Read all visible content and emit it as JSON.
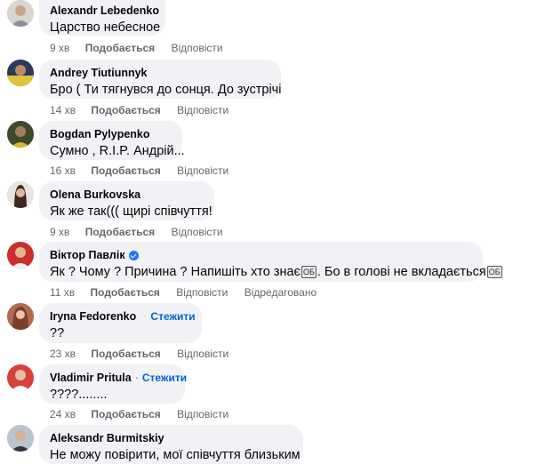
{
  "comments": [
    {
      "name": "Alexandr Lebedenko",
      "verified": false,
      "follow": "",
      "text": "Царство небесное",
      "time": "9 хв",
      "like": "Подобається",
      "reply": "Відповісти",
      "edited": ""
    },
    {
      "name": "Andrey Tiutiunnyk",
      "verified": false,
      "follow": "",
      "text": "Бро ( Ти тягнувся до сонця. До зустрічі",
      "time": "14 хв",
      "like": "Подобається",
      "reply": "Відповісти",
      "edited": ""
    },
    {
      "name": "Bogdan Pylypenko",
      "verified": false,
      "follow": "",
      "text": "Сумно , R.I.P. Андрій...",
      "time": "16 хв",
      "like": "Подобається",
      "reply": "Відповісти",
      "edited": ""
    },
    {
      "name": "Olena Burkovska",
      "verified": false,
      "follow": "",
      "text": "Як же так((( щирі співчуття!",
      "time": "9 хв",
      "like": "Подобається",
      "reply": "Відповісти",
      "edited": ""
    },
    {
      "name": "Віктор Павлік",
      "verified": true,
      "follow": "",
      "text_parts": [
        "Як ? Чому ? Причина ? Напишіть хто знає",
        "ОБ",
        ". Бо в голові не вкладається",
        "ОБ"
      ],
      "time": "11 хв",
      "like": "Подобається",
      "reply": "Відповісти",
      "edited": "Відредаговано"
    },
    {
      "name": "Iryna Fedorenko",
      "verified": true,
      "follow": "Стежити",
      "text": "??",
      "time": "23 хв",
      "like": "Подобається",
      "reply": "Відповісти",
      "edited": ""
    },
    {
      "name": "Vladimir Pritula",
      "verified": false,
      "follow": "Стежити",
      "text": "????........",
      "time": "24 хв",
      "like": "Подобається",
      "reply": "Відповісти",
      "edited": ""
    },
    {
      "name": "Aleksandr Burmitskiy",
      "verified": false,
      "follow": "",
      "text": "Не можу повірити, мої співчуття близьким",
      "time": "",
      "like": "",
      "reply": "",
      "edited": ""
    }
  ],
  "colors": {
    "bubble": "#f0f2f5",
    "link": "#0064d1",
    "verified": "#1877f2",
    "meta": "#65676b"
  }
}
